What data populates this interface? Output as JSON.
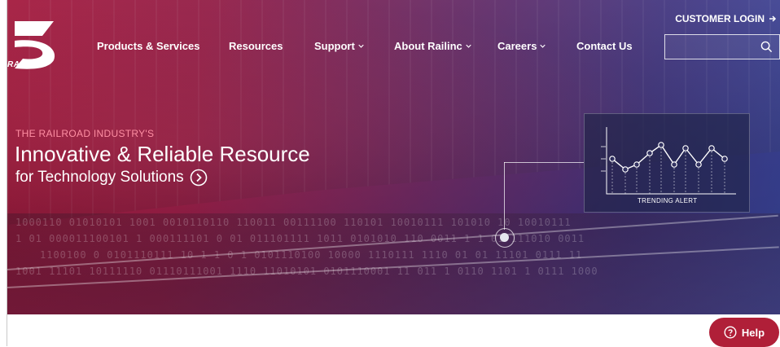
{
  "brand": {
    "logo_text": "RAILINC"
  },
  "header": {
    "customer_login": "CUSTOMER LOGIN",
    "nav": [
      {
        "label": "Products & Services",
        "dropdown": false
      },
      {
        "label": "Resources",
        "dropdown": false
      },
      {
        "label": "Support",
        "dropdown": true
      },
      {
        "label": "About Railinc",
        "dropdown": true
      },
      {
        "label": "Careers",
        "dropdown": true
      },
      {
        "label": "Contact Us",
        "dropdown": false
      }
    ],
    "search": {
      "value": "",
      "placeholder": ""
    }
  },
  "hero": {
    "eyebrow": "THE RAILROAD INDUSTRY'S",
    "headline": "Innovative & Reliable Resource",
    "subhead": "for Technology Solutions",
    "binary_rows": [
      "1000110  01010101 1001 0010110110 110011  00111100 110101 10010111 101010 10 10010111",
      "1 01  000011100101 1 000111101 0  01 011101111 1011 0101010 110 0011  1 1 01 111010 0011",
      "1100100   0 0101110111  10 1 1  0 1 0101110100 10000 1110111 1110  01 01 11101 0111 11",
      "1001 11101 10111110 01110111001 1110 11010101 0101110001 11 011 1 0110 1101 1 0111 1000"
    ],
    "trend_label": "TRENDING ALERT"
  },
  "help": {
    "label": "Help"
  },
  "colors": {
    "hero_start": "#b1173f",
    "hero_end": "#3d4aa6",
    "eyebrow": "#ff8fa3",
    "help_button": "#b01f38"
  }
}
